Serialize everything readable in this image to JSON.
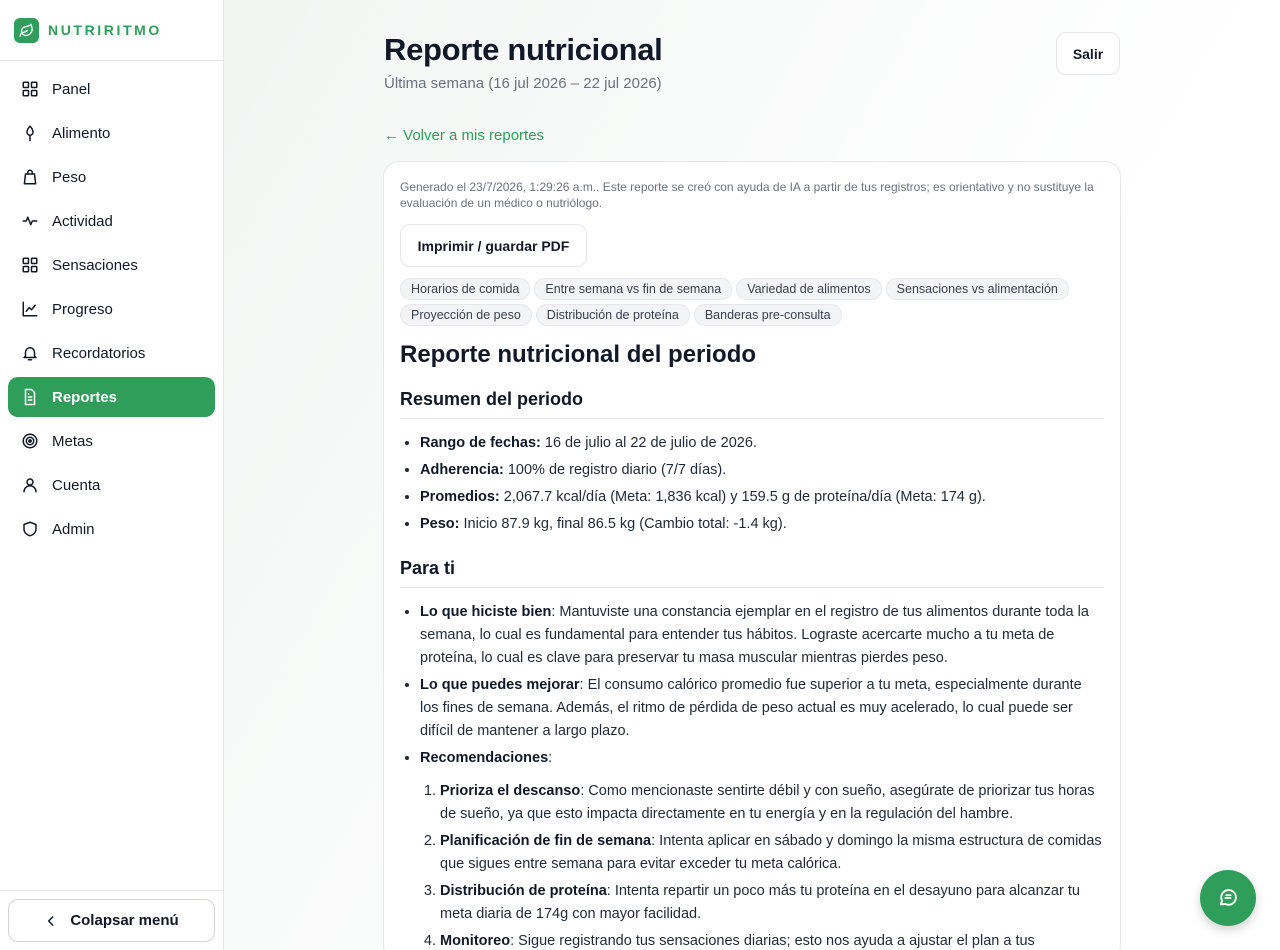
{
  "brand": {
    "name": "NUTRIRITMO"
  },
  "sidebar": {
    "items": [
      {
        "label": "Panel",
        "icon": "grid-icon",
        "active": false
      },
      {
        "label": "Alimento",
        "icon": "leaf-icon",
        "active": false
      },
      {
        "label": "Peso",
        "icon": "bag-icon",
        "active": false
      },
      {
        "label": "Actividad",
        "icon": "pulse-icon",
        "active": false
      },
      {
        "label": "Sensaciones",
        "icon": "grid-icon",
        "active": false
      },
      {
        "label": "Progreso",
        "icon": "chart-icon",
        "active": false
      },
      {
        "label": "Recordatorios",
        "icon": "bell-icon",
        "active": false
      },
      {
        "label": "Reportes",
        "icon": "document-icon",
        "active": true
      },
      {
        "label": "Metas",
        "icon": "target-icon",
        "active": false
      },
      {
        "label": "Cuenta",
        "icon": "user-icon",
        "active": false
      },
      {
        "label": "Admin",
        "icon": "shield-icon",
        "active": false
      }
    ],
    "collapse_label": "Colapsar menú"
  },
  "header": {
    "title": "Reporte nutricional",
    "subtitle": "Última semana (16 jul 2026 – 22 jul 2026)",
    "logout_label": "Salir",
    "back_link": "← Volver a mis reportes"
  },
  "card": {
    "disclaimer": "Generado el 23/7/2026, 1:29:26 a.m.. Este reporte se creó con ayuda de IA a partir de tus registros; es orientativo y no sustituye la evaluación de un médico o nutriólogo.",
    "print_label": "Imprimir / guardar PDF",
    "chips": [
      "Horarios de comida",
      "Entre semana vs fin de semana",
      "Variedad de alimentos",
      "Sensaciones vs alimentación",
      "Proyección de peso",
      "Distribución de proteína",
      "Banderas pre-consulta"
    ]
  },
  "report": {
    "title": "Reporte nutricional del periodo",
    "summary_heading": "Resumen del periodo",
    "summary": [
      {
        "label": "Rango de fechas:",
        "text": " 16 de julio al 22 de julio de 2026."
      },
      {
        "label": "Adherencia:",
        "text": " 100% de registro diario (7/7 días)."
      },
      {
        "label": "Promedios:",
        "text": " 2,067.7 kcal/día (Meta: 1,836 kcal) y 159.5 g de proteína/día (Meta: 174 g)."
      },
      {
        "label": "Peso:",
        "text": " Inicio 87.9 kg, final 86.5 kg (Cambio total: -1.4 kg)."
      }
    ],
    "for_you_heading": "Para ti",
    "for_you": [
      {
        "label": "Lo que hiciste bien",
        "text": ": Mantuviste una constancia ejemplar en el registro de tus alimentos durante toda la semana, lo cual es fundamental para entender tus hábitos. Lograste acercarte mucho a tu meta de proteína, lo cual es clave para preservar tu masa muscular mientras pierdes peso."
      },
      {
        "label": "Lo que puedes mejorar",
        "text": ": El consumo calórico promedio fue superior a tu meta, especialmente durante los fines de semana. Además, el ritmo de pérdida de peso actual es muy acelerado, lo cual puede ser difícil de mantener a largo plazo."
      },
      {
        "label": "Recomendaciones",
        "text": ":"
      }
    ],
    "recommendations": [
      {
        "label": "Prioriza el descanso",
        "text": ": Como mencionaste sentirte débil y con sueño, asegúrate de priorizar tus horas de sueño, ya que esto impacta directamente en tu energía y en la regulación del hambre."
      },
      {
        "label": "Planificación de fin de semana",
        "text": ": Intenta aplicar en sábado y domingo la misma estructura de comidas que sigues entre semana para evitar exceder tu meta calórica."
      },
      {
        "label": "Distribución de proteína",
        "text": ": Intenta repartir un poco más tu proteína en el desayuno para alcanzar tu meta diaria de 174g con mayor facilidad."
      },
      {
        "label": "Monitoreo",
        "text": ": Sigue registrando tus sensaciones diarias; esto nos ayuda a ajustar el plan a tus necesidades."
      }
    ]
  },
  "colors": {
    "accent": "#2f9e5a"
  }
}
